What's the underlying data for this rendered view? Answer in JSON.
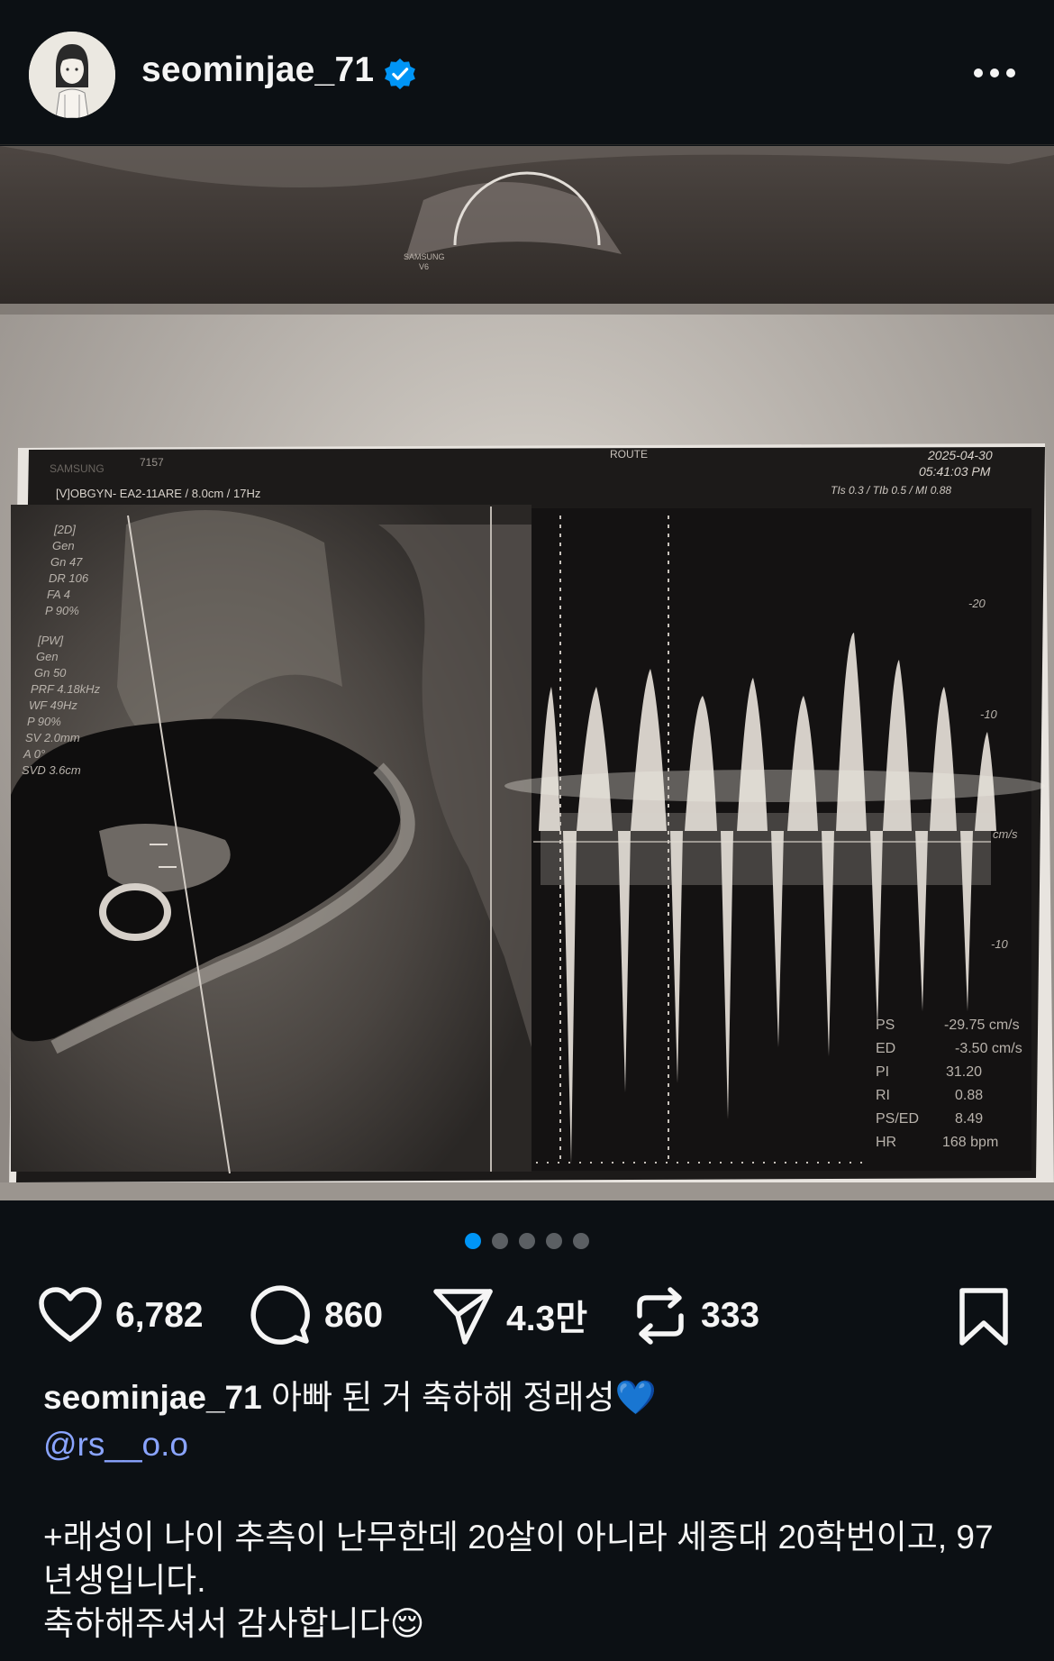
{
  "header": {
    "username": "seominjae_71",
    "verified_icon": "verified-badge-icon",
    "more_icon": "more-horizontal-icon"
  },
  "media": {
    "slide_index": 1,
    "slide_count": 5,
    "ultrasound": {
      "brand_top": "SAMSUNG",
      "probe_code": "7157",
      "preset_line": "[V]OBGYN-  EA2-11ARE / 8.0cm / 17Hz",
      "route": "ROUTE",
      "date": "2025-04-30",
      "time": "05:41:03 PM",
      "indices": "TIs  0.3 / TIb  0.5 / MI  0.88",
      "params_2d": [
        "[2D]",
        "Gen",
        "Gn  47",
        "DR  106",
        "FA  4",
        "P  90%"
      ],
      "params_pw": [
        "[PW]",
        "Gen",
        "Gn  50",
        "PRF 4.18kHz",
        "WF  49Hz",
        "P  90%",
        "SV  2.0mm",
        "A  0°",
        "SVD 3.6cm"
      ],
      "scale_labels": [
        "-20",
        "-10",
        "cm/s",
        "-10"
      ],
      "measurements": [
        {
          "label": "PS",
          "value": "-29.75 cm/s"
        },
        {
          "label": "ED",
          "value": "-3.50 cm/s"
        },
        {
          "label": "PI",
          "value": "31.20"
        },
        {
          "label": "RI",
          "value": "0.88"
        },
        {
          "label": "PS/ED",
          "value": "8.49"
        },
        {
          "label": "HR",
          "value": "168 bpm"
        }
      ],
      "samsung_watermark": "SAMSUNG\nV6"
    }
  },
  "actions": {
    "likes": "6,782",
    "comments": "860",
    "shares": "4.3만",
    "reposts": "333"
  },
  "caption": {
    "username": "seominjae_71",
    "text": "아빠 된 거 축하해 정래성💙",
    "mention": "@rs__o.o",
    "body_lines": [
      "+래성이 나이 추측이 난무한데 20살이 아니라 세종대 20학번이고, 97",
      "년생입니다.",
      "축하해주셔서 감사합니다😌"
    ]
  }
}
